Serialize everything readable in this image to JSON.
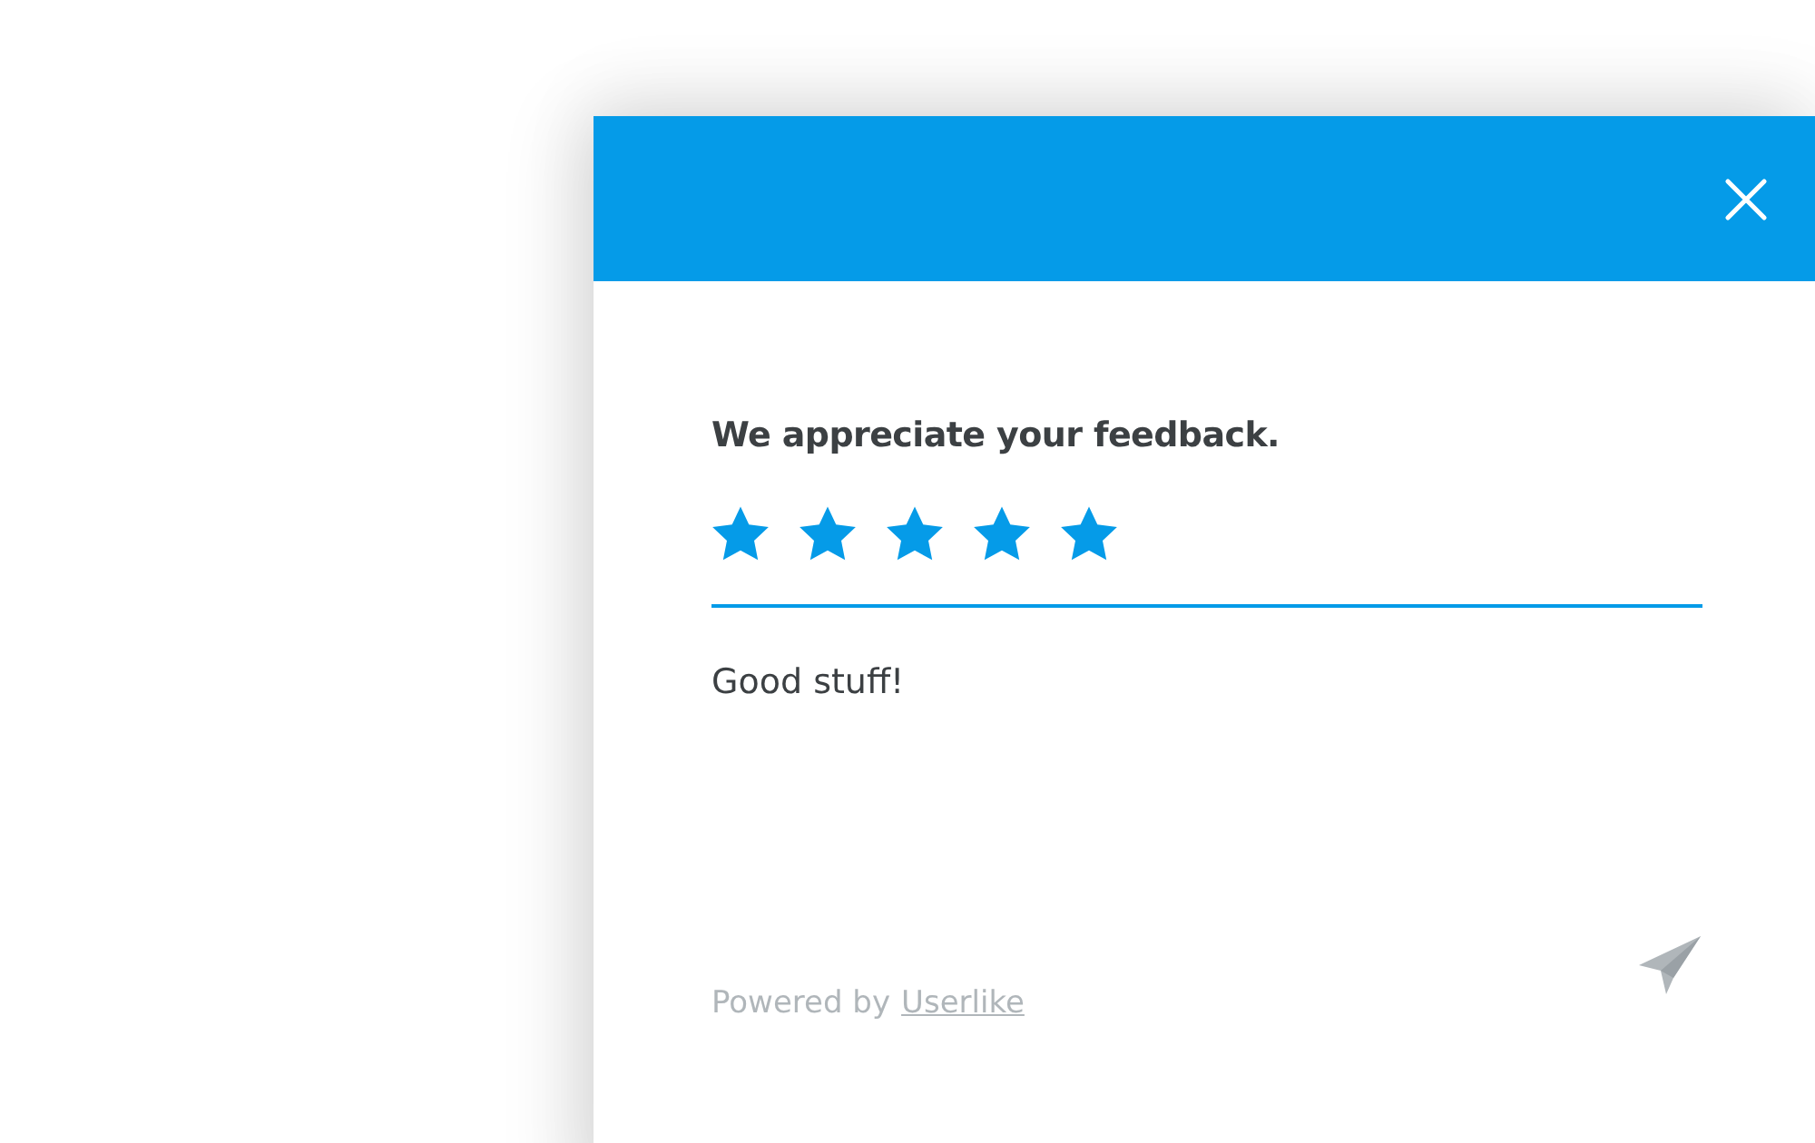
{
  "dialog": {
    "question": "We appreciate your feedback.",
    "rating": {
      "stars": 5
    },
    "comment": {
      "value": "Good stuff!"
    },
    "footer": {
      "text": "Powered by",
      "link": "Userlike"
    }
  }
}
